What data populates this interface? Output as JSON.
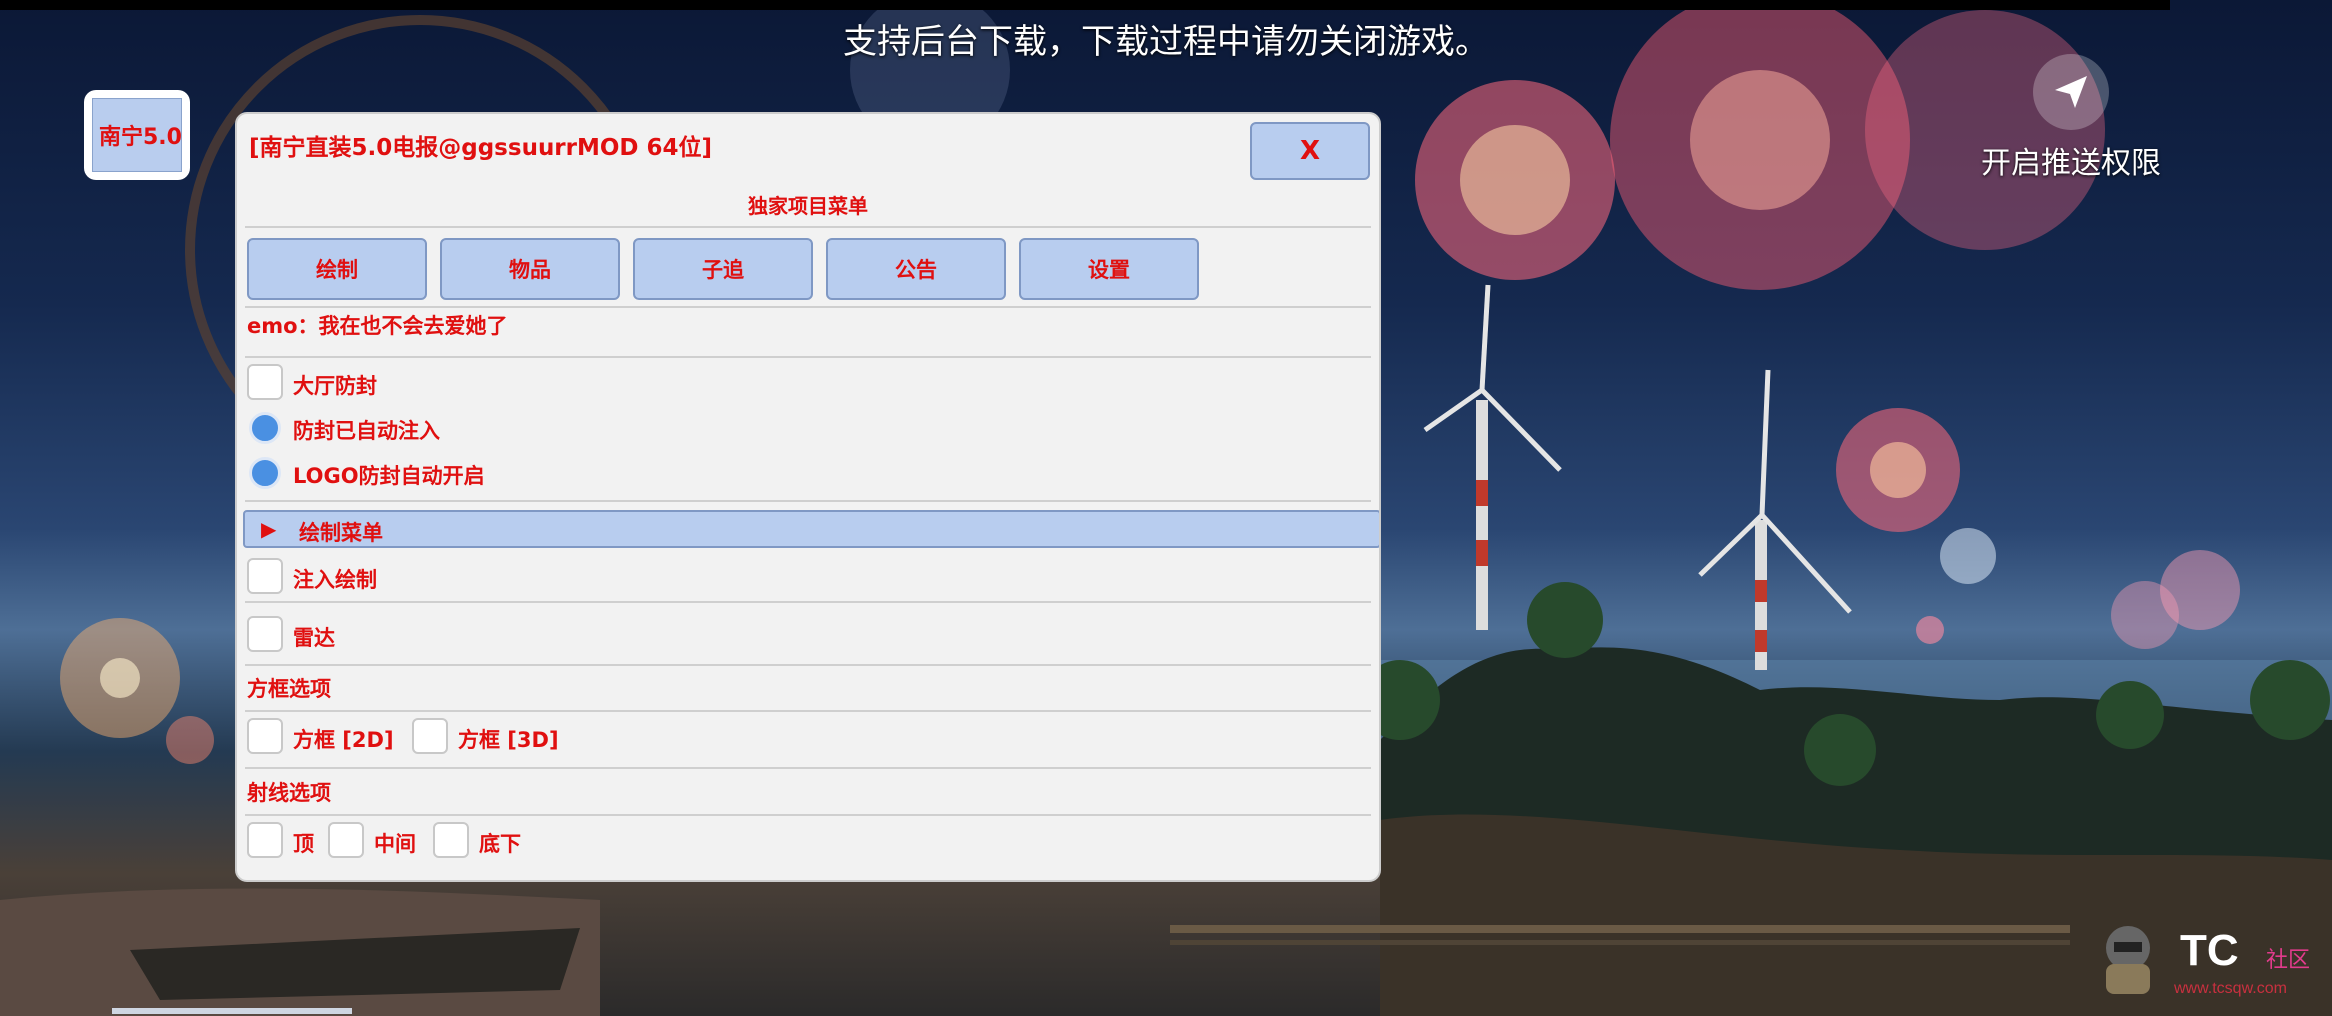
{
  "banner": "支持后台下载，下载过程中请勿关闭游戏。",
  "push": {
    "label": "开启推送权限",
    "icon": "send-icon"
  },
  "float_button": {
    "label": "南宁5.0"
  },
  "panel": {
    "title": "[南宁直装5.0电报@ggssuurrMOD 64位]",
    "close_label": "X",
    "subtitle": "独家项目菜单",
    "tabs": [
      "绘制",
      "物品",
      "子追",
      "公告",
      "设置"
    ],
    "motto": "emo：我在也不会去爱她了",
    "options": [
      {
        "label": "大厅防封",
        "type": "checkbox",
        "checked": false
      },
      {
        "label": "防封已自动注入",
        "type": "radio",
        "checked": true
      },
      {
        "label": "LOGO防封自动开启",
        "type": "radio",
        "checked": true
      }
    ],
    "draw_menu": {
      "label": "绘制菜单",
      "icon": "triangle-right-icon"
    },
    "draw_options": [
      {
        "label": "注入绘制",
        "checked": false
      },
      {
        "label": "雷达",
        "checked": false
      }
    ],
    "box_section": {
      "title": "方框选项",
      "items": [
        {
          "label": "方框 [2D]",
          "checked": false
        },
        {
          "label": "方框 [3D]",
          "checked": false
        }
      ]
    },
    "ray_section": {
      "title": "射线选项",
      "items": [
        {
          "label": "顶",
          "checked": false
        },
        {
          "label": "中间",
          "checked": false
        },
        {
          "label": "底下",
          "checked": false
        }
      ]
    }
  },
  "watermark": {
    "brand": "TC",
    "suffix": "社区",
    "url": "www.tcsqw.com"
  },
  "colors": {
    "accent_red": "#e01010",
    "button_blue": "#b8cdef",
    "radio_blue": "#4a90e2",
    "panel_bg": "#f2f2f2"
  }
}
